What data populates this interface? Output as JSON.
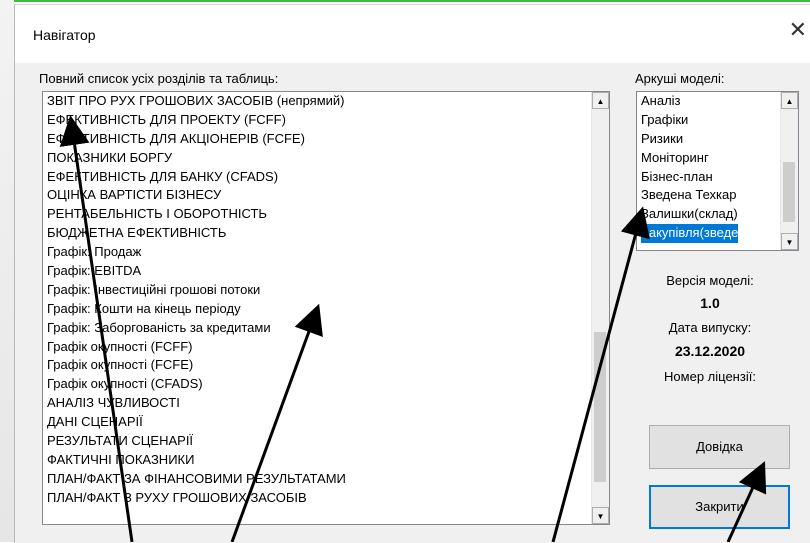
{
  "window": {
    "title": "Навігатор",
    "close_glyph": "✕"
  },
  "sections": {
    "label": "Повний список усіх розділів та таблиць:",
    "items": [
      "ЗВІТ ПРО РУХ ГРОШОВИХ ЗАСОБІВ (непрямий)",
      "ЕФЕКТИВНІСТЬ ДЛЯ ПРОЕКТУ (FCFF)",
      "ЕФЕКТИВНІСТЬ ДЛЯ АКЦІОНЕРІВ (FCFE)",
      "ПОКАЗНИКИ БОРГУ",
      "ЕФЕКТИВНІСТЬ ДЛЯ БАНКУ (CFADS)",
      "ОЦІНКА ВАРТІСТИ БІЗНЕСУ",
      "РЕНТАБЕЛЬНІСТЬ І ОБОРОТНІСТЬ",
      "БЮДЖЕТНА ЕФЕКТИВНІСТЬ",
      "Графік: Продаж",
      "Графік: EBITDA",
      "Графік: Інвестиційні грошові потоки",
      "Графік: Кошти на кінець періоду",
      "Графік: Заборгованість за кредитами",
      "Графік окупності (FCFF)",
      "Графік окупності (FCFE)",
      "Графік окупності (CFADS)",
      "АНАЛІЗ ЧУВЛИВОСТІ",
      "ДАНІ СЦЕНАРІЇ",
      "РЕЗУЛЬТАТИ СЦЕНАРІЇ",
      "ФАКТИЧНІ ПОКАЗНИКИ",
      "ПЛАН/ФАКТ ЗА ФІНАНСОВИМИ РЕЗУЛЬТАТАМИ",
      "ПЛАН/ФАКТ З РУХУ ГРОШОВИХ ЗАСОБІВ"
    ]
  },
  "sheets": {
    "label": "Аркуші моделі:",
    "items": [
      "Аналіз",
      "Графіки",
      "Ризики",
      "Моніторинг",
      "Бізнес-план",
      "Зведена Техкар",
      "Залишки(склад)",
      "Закупівля(зведе"
    ],
    "selected_index": 7
  },
  "model_info": {
    "version_label": "Версія моделі:",
    "version_value": "1.0",
    "date_label": "Дата випуску:",
    "date_value": "23.12.2020",
    "license_label": "Номер ліцензії:",
    "license_value": ""
  },
  "buttons": {
    "help": "Довідка",
    "close": "Закрити"
  },
  "scroll_glyphs": {
    "up": "▲",
    "down": "▼"
  },
  "colors": {
    "selection": "#0078d7",
    "arrow": "#000000",
    "top_bar": "#3cba3c"
  }
}
